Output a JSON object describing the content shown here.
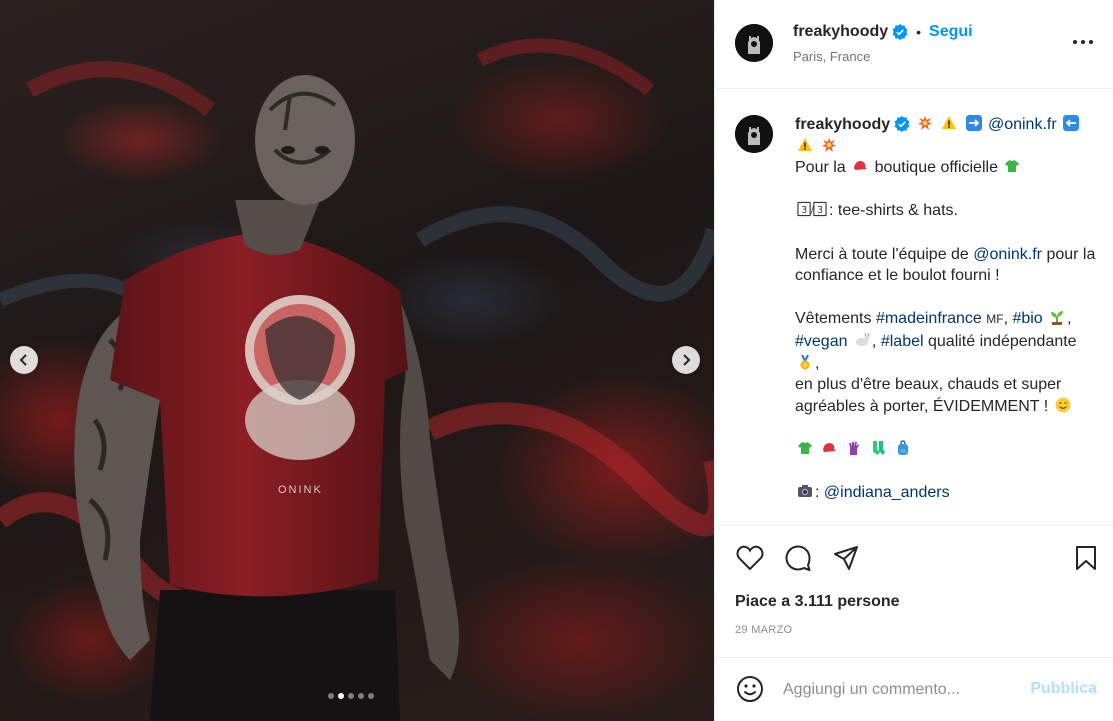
{
  "post": {
    "username": "freakyhoody",
    "follow_label": "Segui",
    "separator": "•",
    "location": "Paris, France"
  },
  "caption": {
    "username": "freakyhoody",
    "mention_1": "@onink.fr",
    "line_intro_a": "Pour la",
    "line_intro_b": "boutique officielle",
    "line_items": "tee-shirts & hats.",
    "line_thanks_a": "Merci à toute l'équipe de",
    "line_thanks_mention": "@onink.fr",
    "line_thanks_b": "pour la confiance et le boulot fourni !",
    "vetements_prefix": "Vêtements",
    "tag_madeinfrance": "#madeinfrance",
    "mf_flag": "MF",
    "tag_bio": "#bio",
    "tag_vegan": "#vegan",
    "tag_label": "#label",
    "label_suffix": "qualité indépendante",
    "line_extra": "en plus d'être beaux, chauds et super agréables à porter, ÉVIDEMMENT !",
    "photo_credit": "@indiana_anders"
  },
  "stats": {
    "likes": "Piace a 3.111 persone",
    "date": "29 MARZO"
  },
  "comment": {
    "placeholder": "Aggiungi un commento...",
    "publish_label": "Pubblica"
  },
  "carousel": {
    "slide_count": 5,
    "active_index": 1
  },
  "colors": {
    "accent": "#0095f6",
    "link": "#00376b",
    "publish_disabled": "#b2dffc",
    "shirt": "#8b1e24"
  },
  "icons": [
    "verified-badge-icon",
    "more-options-icon",
    "chevron-left-icon",
    "chevron-right-icon",
    "heart-icon",
    "comment-icon",
    "share-icon",
    "bookmark-icon",
    "emoji-icon"
  ]
}
